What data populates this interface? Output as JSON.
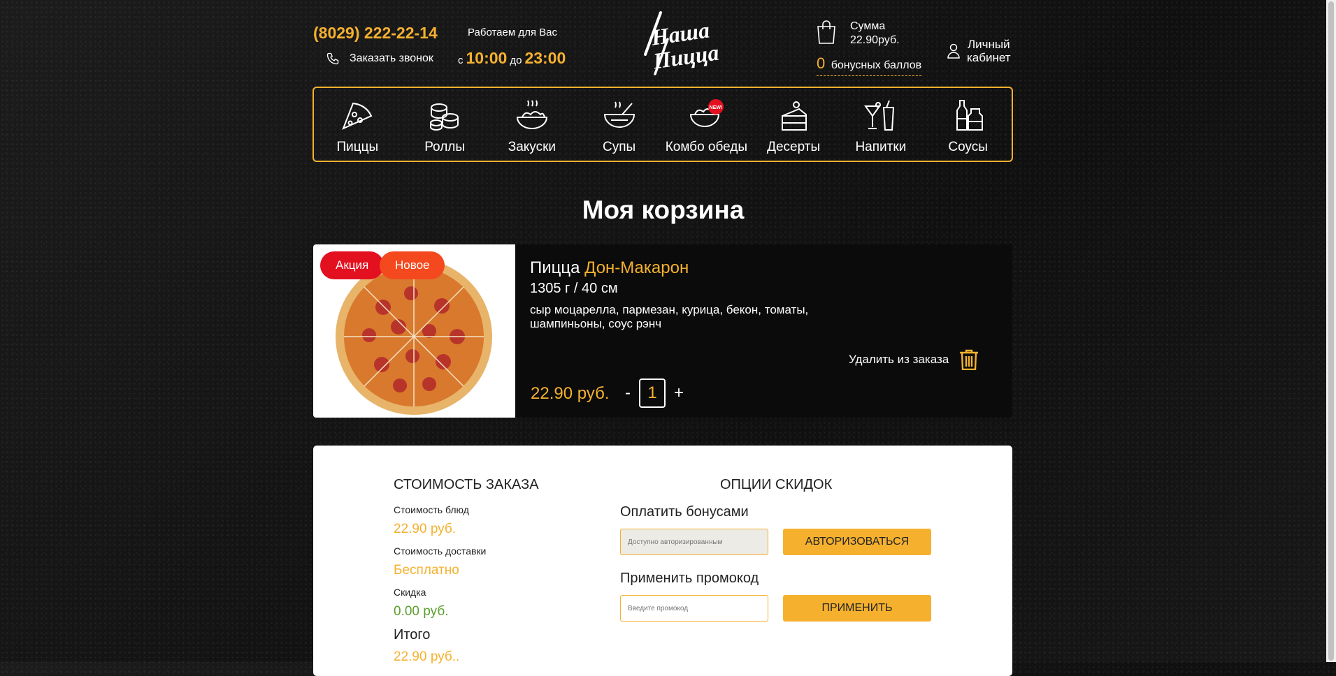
{
  "header": {
    "phone": "(8029) 222-22-14",
    "callback_label": "Заказать звонок",
    "work_label": "Работаем для Вас",
    "hours_from_prefix": "с",
    "hours_from": "10:00",
    "hours_to_prefix": "до",
    "hours_to": "23:00",
    "logo_text_1": "Наша",
    "logo_text_2": "Пицца",
    "cart_sum_label": "Сумма",
    "cart_sum_value": "22.90руб.",
    "bonus_count": "0",
    "bonus_label": "бонусных баллов",
    "cabinet_label_1": "Личный",
    "cabinet_label_2": "кабинет"
  },
  "nav": {
    "items": [
      {
        "label": "Пиццы",
        "icon": "pizza-slice-icon"
      },
      {
        "label": "Роллы",
        "icon": "rolls-icon"
      },
      {
        "label": "Закуски",
        "icon": "snacks-icon"
      },
      {
        "label": "Супы",
        "icon": "soup-icon"
      },
      {
        "label": "Комбо обеды",
        "icon": "combo-icon",
        "badge": "NEW!"
      },
      {
        "label": "Десерты",
        "icon": "cake-icon"
      },
      {
        "label": "Напитки",
        "icon": "drinks-icon"
      },
      {
        "label": "Соусы",
        "icon": "sauces-icon"
      }
    ]
  },
  "page": {
    "title": "Моя корзина"
  },
  "cart_item": {
    "badge_sale": "Акция",
    "badge_new": "Новое",
    "name_prefix": "Пицца",
    "name": "Дон-Макарон",
    "weight": "1305 г / 40 см",
    "description": "сыр моцарелла, пармезан, курица, бекон, томаты, шампиньоны, соус рэнч",
    "delete_label": "Удалить из заказа",
    "price": "22.90 руб.",
    "qty_minus": "-",
    "qty": "1",
    "qty_plus": "+"
  },
  "summary": {
    "title": "СТОИМОСТЬ ЗАКАЗА",
    "dishes_label": "Стоимость блюд",
    "dishes_value": "22.90 руб.",
    "delivery_label": "Стоимость доставки",
    "delivery_value": "Бесплатно",
    "discount_label": "Скидка",
    "discount_value": "0.00 руб.",
    "total_label": "Итого",
    "total_value": "22.90 руб.."
  },
  "discounts": {
    "title": "ОПЦИИ СКИДОК",
    "pay_bonus_label": "Оплатить бонусами",
    "bonus_placeholder": "Доступно авторизированным",
    "auth_button": "АВТОРИЗОВАТЬСЯ",
    "promo_label": "Применить промокод",
    "promo_placeholder": "Введите промокод",
    "apply_button": "ПРИМЕНИТЬ"
  },
  "colors": {
    "accent": "#f5b12e",
    "sale_badge": "#e3101f",
    "new_badge": "#f4491f",
    "discount_green": "#5aa02c"
  }
}
